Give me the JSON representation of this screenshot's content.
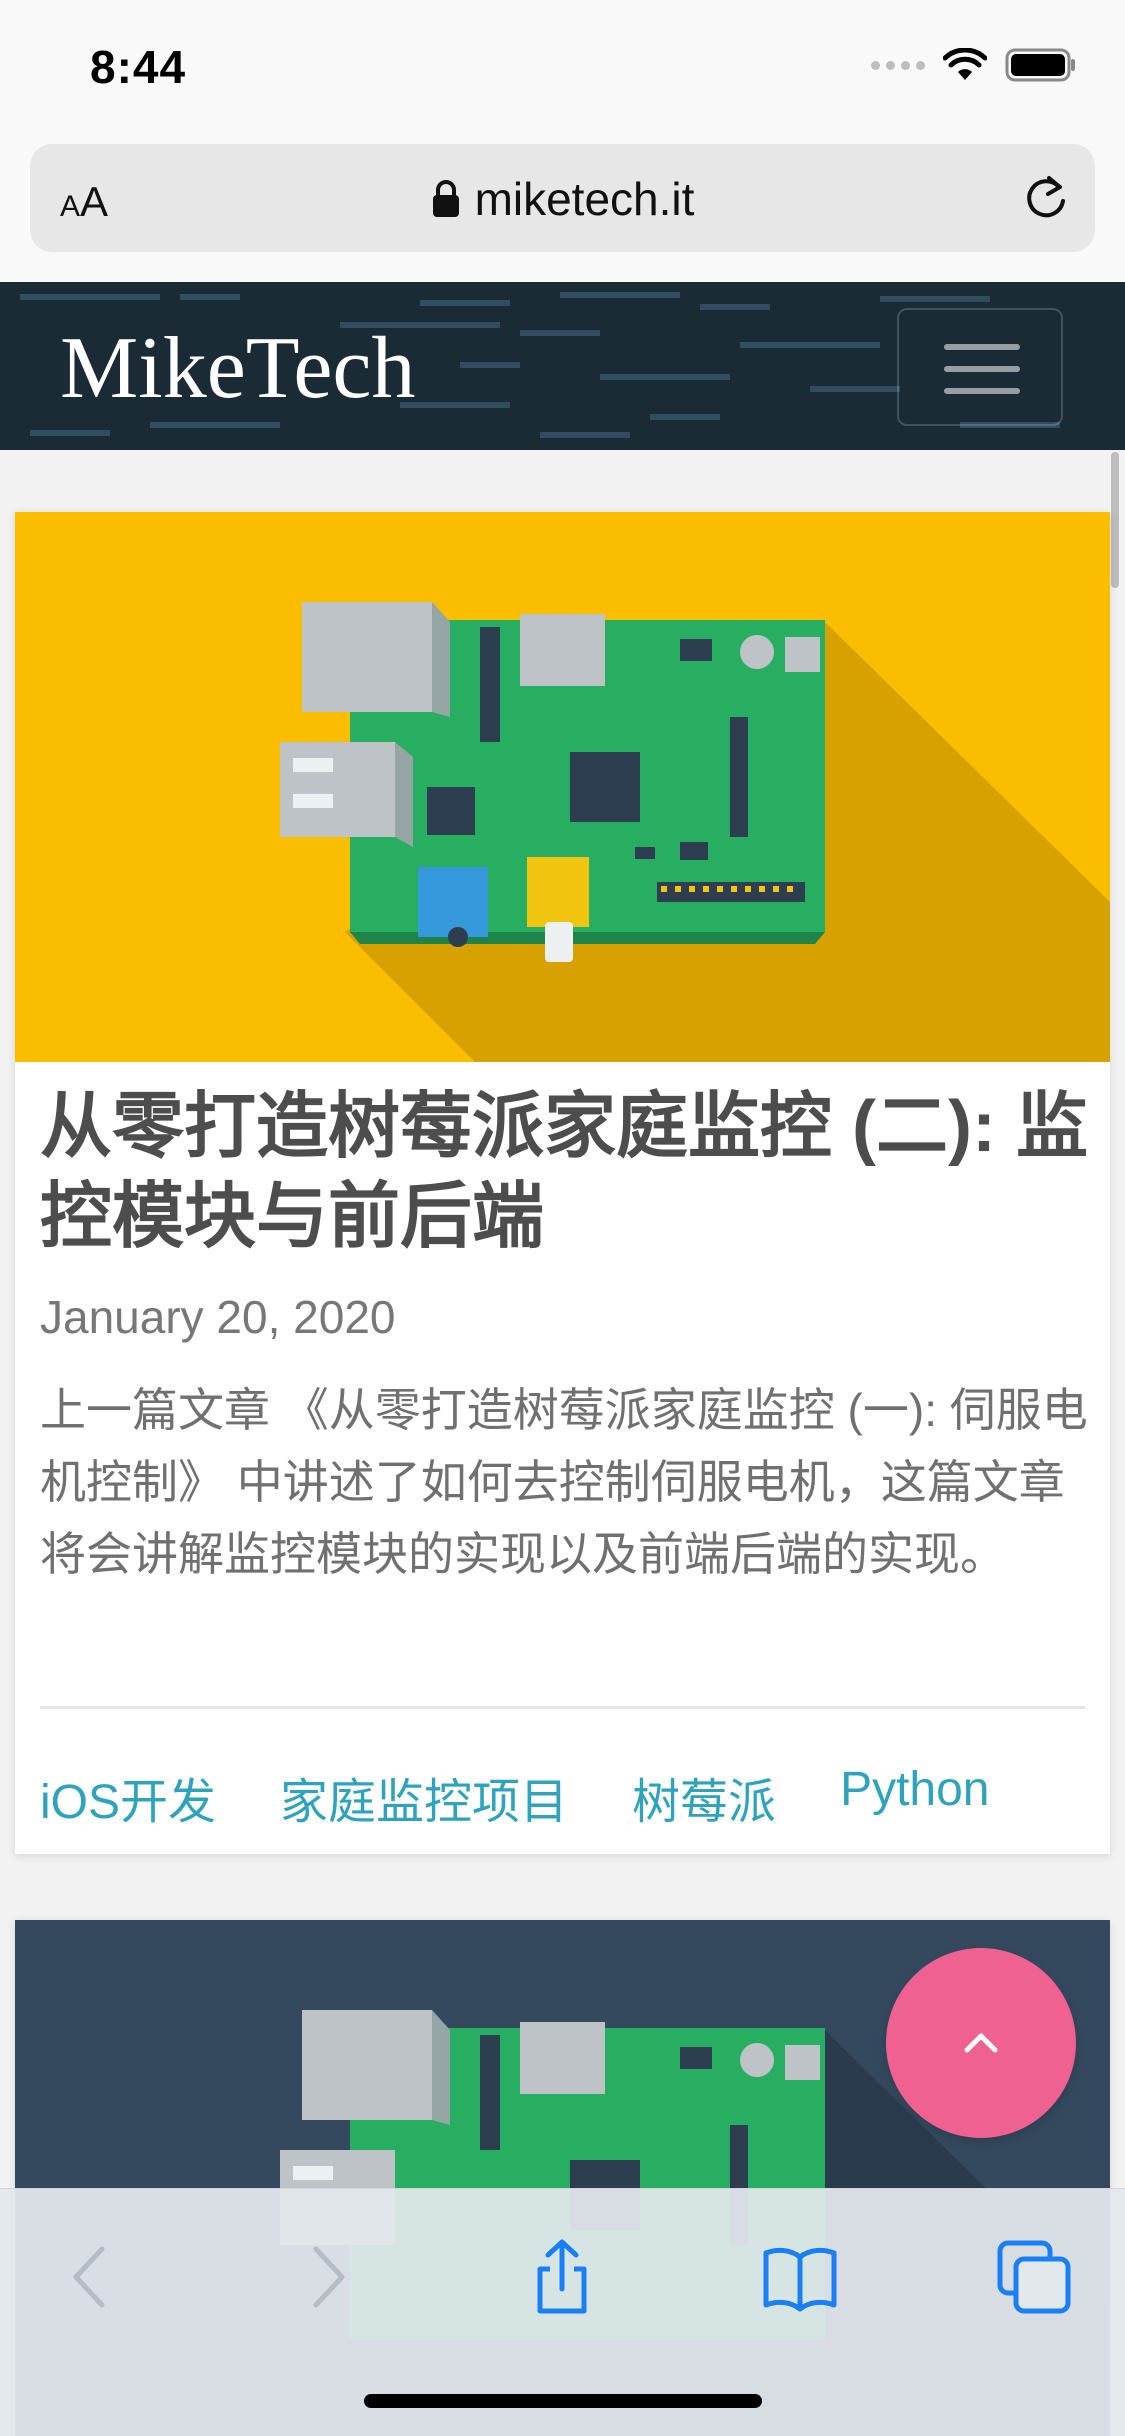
{
  "status_bar": {
    "time": "8:44"
  },
  "browser": {
    "text_size_small": "A",
    "text_size_large": "A",
    "url": "miketech.it"
  },
  "site": {
    "logo": "MikeTech"
  },
  "posts": [
    {
      "title": "从零打造树莓派家庭监控 (二): 监控模块与前后端",
      "date": "January 20, 2020",
      "excerpt": "上一篇文章 《从零打造树莓派家庭监控 (一): 伺服电机控制》 中讲述了如何去控制伺服电机，这篇文章将会讲解监控模块的实现以及前端后端的实现。",
      "tags": [
        "iOS开发",
        "家庭监控项目",
        "树莓派",
        "Python"
      ],
      "image_bg_color": "#fbbd00"
    },
    {
      "image_bg_color": "#34495e"
    }
  ],
  "colors": {
    "header_bg": "#1a2b36",
    "tag_link": "#2fa3bd",
    "fab": "#ef6190",
    "toolbar_icon_active": "#1a7ef5",
    "toolbar_icon_disabled": "#b6bcc3"
  },
  "icons": {
    "status": [
      "cellular-signal-icon",
      "wifi-icon",
      "battery-icon"
    ],
    "url_bar": [
      "lock-icon",
      "reload-icon"
    ],
    "toolbar": [
      "back-icon",
      "forward-icon",
      "share-icon",
      "bookmarks-icon",
      "tabs-icon"
    ],
    "fab": "chevron-up-icon"
  }
}
